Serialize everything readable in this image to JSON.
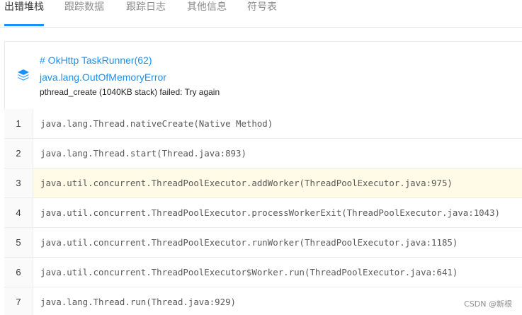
{
  "tabs": [
    {
      "label": "出错堆栈",
      "active": true
    },
    {
      "label": "跟踪数据",
      "active": false
    },
    {
      "label": "跟踪日志",
      "active": false
    },
    {
      "label": "其他信息",
      "active": false
    },
    {
      "label": "符号表",
      "active": false
    }
  ],
  "error": {
    "icon": "layers-icon",
    "thread": "# OkHttp TaskRunner(62)",
    "type": "java.lang.OutOfMemoryError",
    "message": "pthread_create (1040KB stack) failed: Try again"
  },
  "stack": [
    {
      "num": "1",
      "text": "java.lang.Thread.nativeCreate(Native Method)",
      "highlight": false
    },
    {
      "num": "2",
      "text": "java.lang.Thread.start(Thread.java:893)",
      "highlight": false
    },
    {
      "num": "3",
      "text": "java.util.concurrent.ThreadPoolExecutor.addWorker(ThreadPoolExecutor.java:975)",
      "highlight": true
    },
    {
      "num": "4",
      "text": "java.util.concurrent.ThreadPoolExecutor.processWorkerExit(ThreadPoolExecutor.java:1043)",
      "highlight": false
    },
    {
      "num": "5",
      "text": "java.util.concurrent.ThreadPoolExecutor.runWorker(ThreadPoolExecutor.java:1185)",
      "highlight": false
    },
    {
      "num": "6",
      "text": "java.util.concurrent.ThreadPoolExecutor$Worker.run(ThreadPoolExecutor.java:641)",
      "highlight": false
    },
    {
      "num": "7",
      "text": "java.lang.Thread.run(Thread.java:929)",
      "highlight": false
    }
  ],
  "watermark": "CSDN @新根",
  "colors": {
    "accent": "#1890ff",
    "highlight_row": "#fffbe6"
  }
}
